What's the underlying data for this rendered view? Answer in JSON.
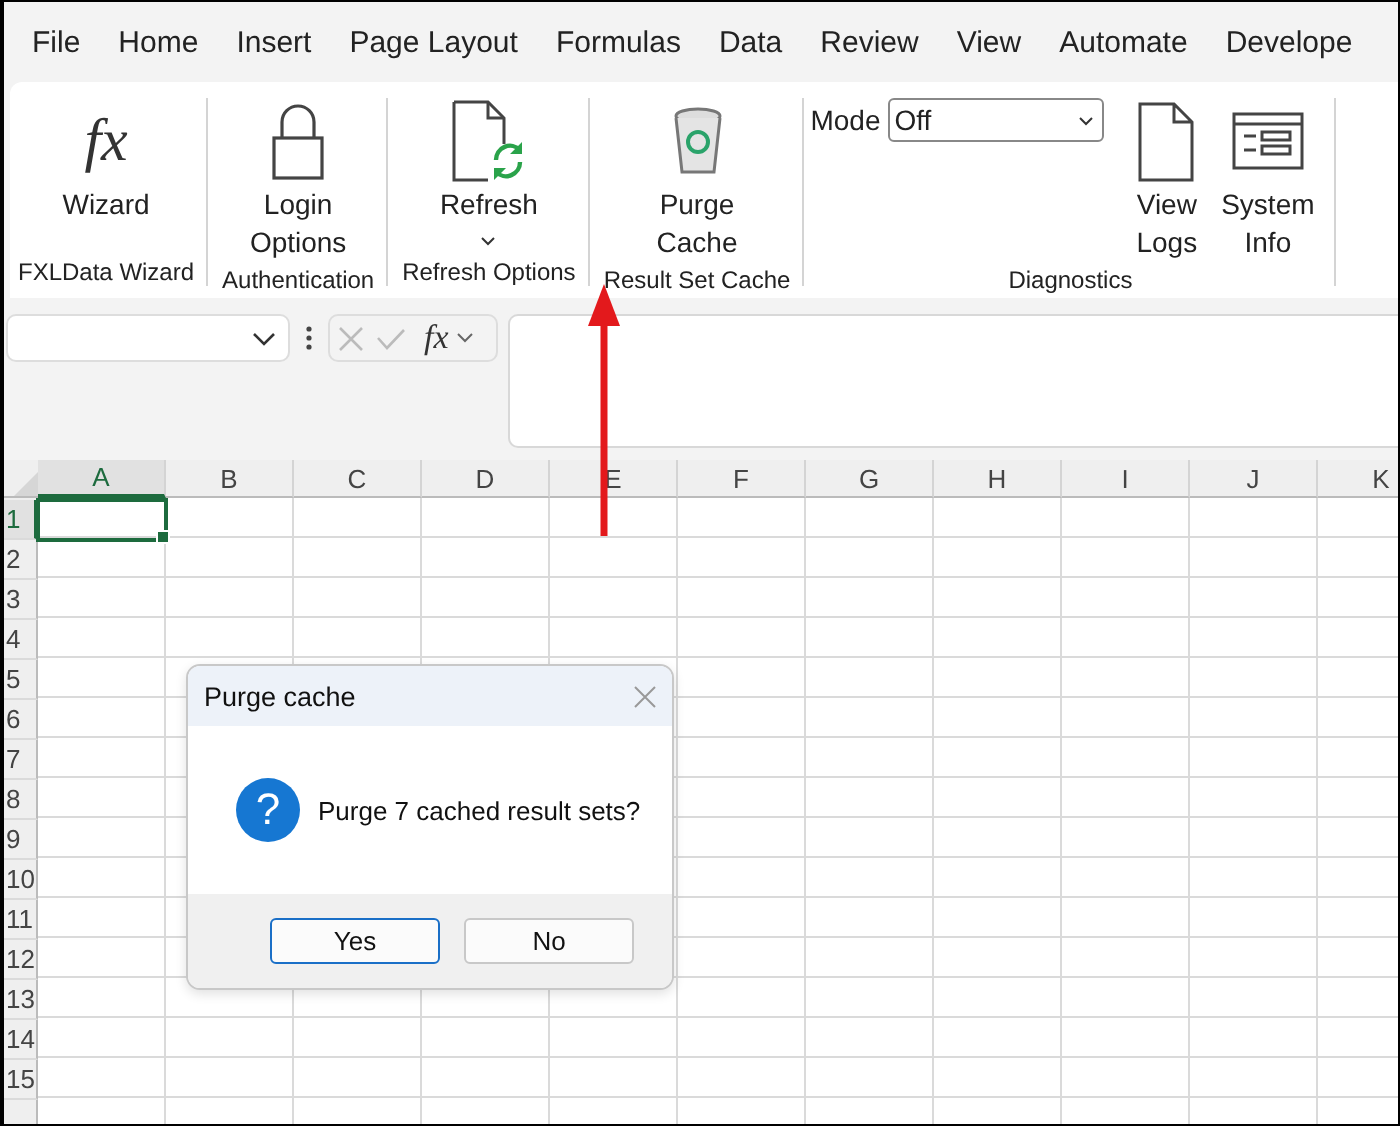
{
  "menu_tabs": [
    {
      "label": "File"
    },
    {
      "label": "Home"
    },
    {
      "label": "Insert"
    },
    {
      "label": "Page Layout"
    },
    {
      "label": "Formulas"
    },
    {
      "label": "Data"
    },
    {
      "label": "Review"
    },
    {
      "label": "View"
    },
    {
      "label": "Automate"
    },
    {
      "label": "Develope"
    }
  ],
  "ribbon": {
    "groups": [
      {
        "label": "FXLData Wizard",
        "items": [
          {
            "kind": "glyph-button",
            "glyph": "fx",
            "label": "Wizard"
          }
        ]
      },
      {
        "label": "Authentication",
        "items": [
          {
            "kind": "button",
            "label": "Login Options"
          }
        ]
      },
      {
        "label": "Refresh Options",
        "items": [
          {
            "kind": "split-button",
            "label": "Refresh"
          }
        ]
      },
      {
        "label": "Result Set Cache",
        "items": [
          {
            "kind": "button",
            "label": "Purge Cache"
          }
        ]
      },
      {
        "label": "Diagnostics",
        "items": [
          {
            "kind": "combo",
            "label": "Mode",
            "value": "Off"
          },
          {
            "kind": "button",
            "label": "View Logs"
          },
          {
            "kind": "button",
            "label": "System Info"
          }
        ]
      }
    ]
  },
  "formula_bar": {
    "insert_function": "fx"
  },
  "sheet": {
    "columns": [
      {
        "label": "A",
        "selected": true
      },
      {
        "label": "B",
        "selected": false
      },
      {
        "label": "C",
        "selected": false
      },
      {
        "label": "D",
        "selected": false
      },
      {
        "label": "E",
        "selected": false
      },
      {
        "label": "F",
        "selected": false
      },
      {
        "label": "G",
        "selected": false
      },
      {
        "label": "H",
        "selected": false
      },
      {
        "label": "I",
        "selected": false
      },
      {
        "label": "J",
        "selected": false
      },
      {
        "label": "K",
        "selected": false
      }
    ],
    "rows": [
      {
        "label": "1",
        "selected": true
      },
      {
        "label": "2",
        "selected": false
      },
      {
        "label": "3",
        "selected": false
      },
      {
        "label": "4",
        "selected": false
      },
      {
        "label": "5",
        "selected": false
      },
      {
        "label": "6",
        "selected": false
      },
      {
        "label": "7",
        "selected": false
      },
      {
        "label": "8",
        "selected": false
      },
      {
        "label": "9",
        "selected": false
      },
      {
        "label": "10",
        "selected": false
      },
      {
        "label": "11",
        "selected": false
      },
      {
        "label": "12",
        "selected": false
      },
      {
        "label": "13",
        "selected": false
      },
      {
        "label": "14",
        "selected": false
      },
      {
        "label": "15",
        "selected": false
      }
    ]
  },
  "dialog": {
    "title": "Purge cache",
    "icon_glyph": "?",
    "message": "Purge 7 cached result sets?",
    "buttons": [
      {
        "label": "Yes",
        "focused": true
      },
      {
        "label": "No",
        "focused": false
      }
    ]
  }
}
